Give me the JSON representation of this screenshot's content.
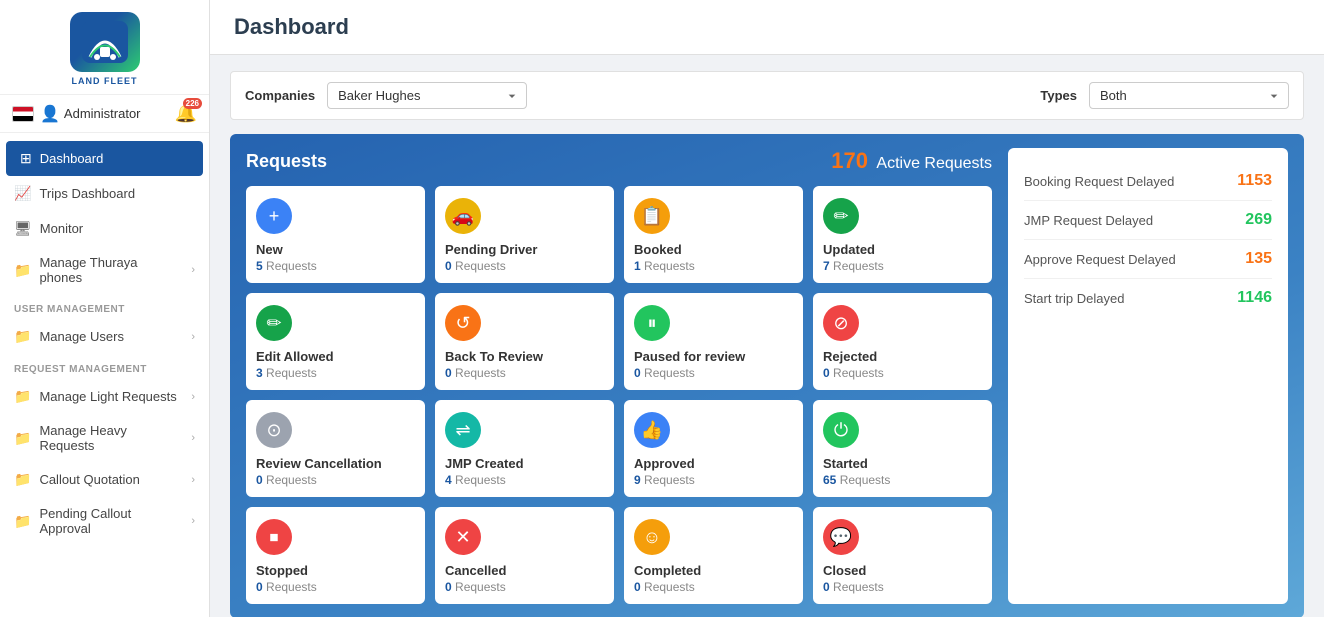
{
  "app": {
    "title": "Dashboard"
  },
  "sidebar": {
    "logo_text": "LAND FLEET",
    "user": {
      "name": "Administrator"
    },
    "bell_badge": "226",
    "nav_items": [
      {
        "id": "dashboard",
        "label": "Dashboard",
        "icon": "grid",
        "active": true
      },
      {
        "id": "trips-dashboard",
        "label": "Trips Dashboard",
        "icon": "chart"
      },
      {
        "id": "monitor",
        "label": "Monitor",
        "icon": "monitor"
      },
      {
        "id": "manage-thuraya",
        "label": "Manage Thuraya phones",
        "icon": "folder",
        "has_children": true
      }
    ],
    "section_user_mgmt": "USER MANAGEMENT",
    "section_request_mgmt": "REQUEST MANAGEMENT",
    "user_mgmt_items": [
      {
        "id": "manage-users",
        "label": "Manage Users",
        "icon": "folder",
        "has_children": true
      }
    ],
    "request_mgmt_items": [
      {
        "id": "manage-light",
        "label": "Manage Light Requests",
        "icon": "folder",
        "has_children": true
      },
      {
        "id": "manage-heavy",
        "label": "Manage Heavy Requests",
        "icon": "folder",
        "has_children": true
      },
      {
        "id": "callout-quotation",
        "label": "Callout Quotation",
        "icon": "folder",
        "has_children": true
      },
      {
        "id": "pending-callout",
        "label": "Pending Callout Approval",
        "icon": "folder",
        "has_children": true
      }
    ]
  },
  "filters": {
    "companies_label": "Companies",
    "companies_value": "Baker Hughes",
    "types_label": "Types",
    "types_value": "Both"
  },
  "requests": {
    "section_title": "Requests",
    "active_count": "170",
    "active_label": "Active Requests",
    "cards": [
      {
        "id": "new",
        "title": "New",
        "count": 5,
        "label": "Requests",
        "icon": "＋",
        "bg": "bg-blue"
      },
      {
        "id": "pending-driver",
        "title": "Pending Driver",
        "count": 0,
        "label": "Requests",
        "icon": "🚗",
        "bg": "bg-yellow"
      },
      {
        "id": "booked",
        "title": "Booked",
        "count": 1,
        "label": "Requests",
        "icon": "📋",
        "bg": "bg-amber"
      },
      {
        "id": "updated",
        "title": "Updated",
        "count": 7,
        "label": "Requests",
        "icon": "✎",
        "bg": "bg-green-dark"
      },
      {
        "id": "edit-allowed",
        "title": "Edit Allowed",
        "count": 3,
        "label": "Requests",
        "icon": "✎",
        "bg": "bg-green-dark"
      },
      {
        "id": "back-to-review",
        "title": "Back To Review",
        "count": 0,
        "label": "Requests",
        "icon": "↺",
        "bg": "bg-orange"
      },
      {
        "id": "paused-review",
        "title": "Paused for review",
        "count": 0,
        "label": "Requests",
        "icon": "⏸",
        "bg": "bg-green"
      },
      {
        "id": "rejected",
        "title": "Rejected",
        "count": 0,
        "label": "Requests",
        "icon": "⊘",
        "bg": "bg-red"
      },
      {
        "id": "review-cancellation",
        "title": "Review Cancellation",
        "count": 0,
        "label": "Requests",
        "icon": "⊙",
        "bg": "bg-gray"
      },
      {
        "id": "jmp-created",
        "title": "JMP Created",
        "count": 4,
        "label": "Requests",
        "icon": "⇌",
        "bg": "bg-teal"
      },
      {
        "id": "approved",
        "title": "Approved",
        "count": 9,
        "label": "Requests",
        "icon": "👍",
        "bg": "bg-blue"
      },
      {
        "id": "started",
        "title": "Started",
        "count": 65,
        "label": "Requests",
        "icon": "⏻",
        "bg": "bg-green"
      },
      {
        "id": "row4-1",
        "title": "Stopped",
        "count": 0,
        "label": "Requests",
        "icon": "⏹",
        "bg": "bg-red"
      },
      {
        "id": "row4-2",
        "title": "Cancelled",
        "count": 0,
        "label": "Requests",
        "icon": "✕",
        "bg": "bg-red"
      },
      {
        "id": "row4-3",
        "title": "Completed",
        "count": 0,
        "label": "Requests",
        "icon": "☺",
        "bg": "bg-amber"
      },
      {
        "id": "row4-4",
        "title": "Closed",
        "count": 0,
        "label": "Requests",
        "icon": "💬",
        "bg": "bg-red"
      }
    ]
  },
  "delayed": {
    "rows": [
      {
        "id": "booking-delayed",
        "label": "Booking Request Delayed",
        "value": "1153",
        "color": "orange"
      },
      {
        "id": "jmp-delayed",
        "label": "JMP Request Delayed",
        "value": "269",
        "color": "green"
      },
      {
        "id": "approve-delayed",
        "label": "Approve Request Delayed",
        "value": "135",
        "color": "orange"
      },
      {
        "id": "start-trip-delayed",
        "label": "Start trip Delayed",
        "value": "1146",
        "color": "green"
      }
    ]
  }
}
